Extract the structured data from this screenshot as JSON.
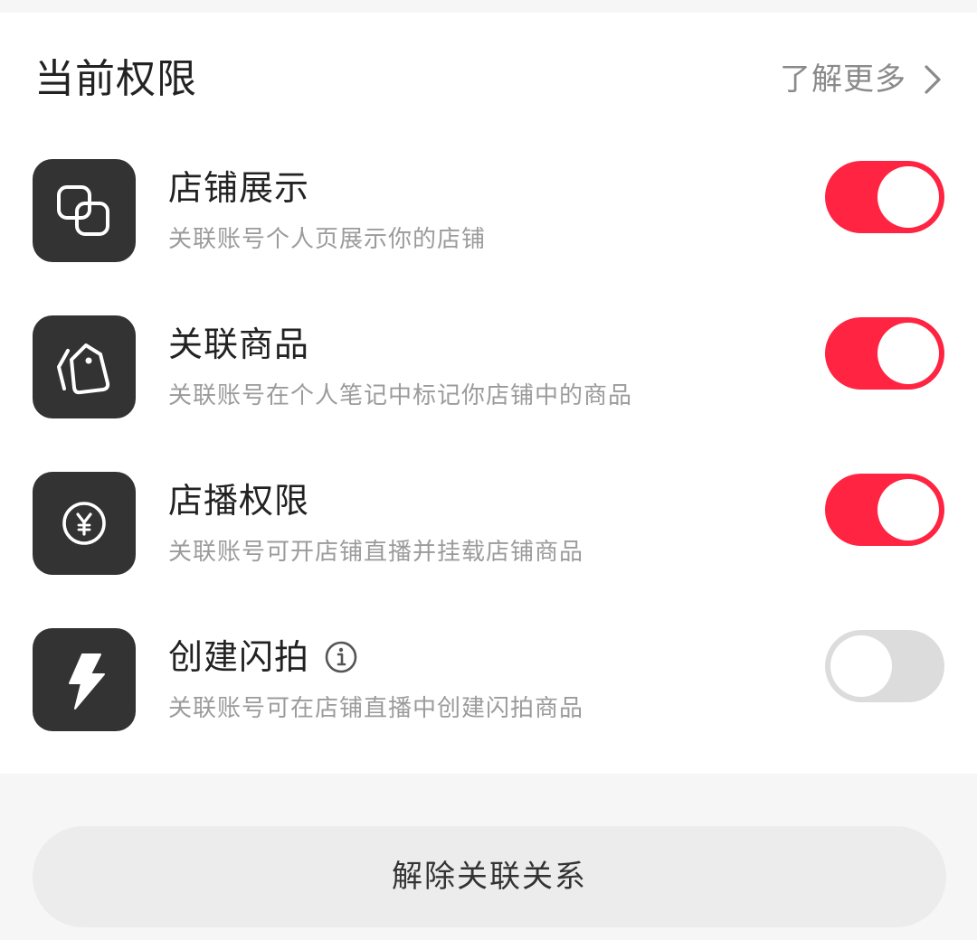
{
  "header": {
    "title": "当前权限",
    "learn_more": "了解更多",
    "learn_more_icon": "chevron-right-icon"
  },
  "permissions": [
    {
      "title": "店铺展示",
      "description": "关联账号个人页展示你的店铺",
      "icon": "overlapping-squares-icon",
      "enabled": true
    },
    {
      "title": "关联商品",
      "description": "关联账号在个人笔记中标记你店铺中的商品",
      "icon": "price-tag-icon",
      "enabled": true
    },
    {
      "title": "店播权限",
      "description": "关联账号可开店铺直播并挂载店铺商品",
      "icon": "yuan-coin-icon",
      "enabled": true
    },
    {
      "title": "创建闪拍",
      "description": "关联账号可在店铺直播中创建闪拍商品",
      "icon": "lightning-bolt-icon",
      "info_icon": "info-icon",
      "enabled": false
    }
  ],
  "footer": {
    "unlink_label": "解除关联关系"
  },
  "colors": {
    "toggle_on": "#ff2441",
    "toggle_off": "#dcdcdc",
    "icon_tile": "#333333"
  }
}
